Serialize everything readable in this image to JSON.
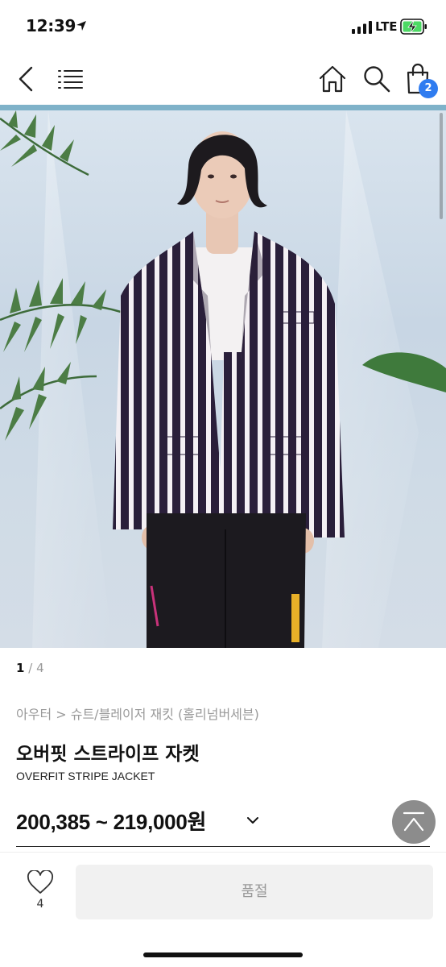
{
  "status_bar": {
    "time": "12:39",
    "network": "LTE"
  },
  "nav": {
    "cart_count": "2"
  },
  "gallery": {
    "current": "1",
    "separator": "/",
    "total": "4"
  },
  "product": {
    "breadcrumb": "아우터 > 슈트/블레이저 재킷 (홀리넘버세븐)",
    "title": "오버핏 스트라이프 자켓",
    "subtitle": "OVERFIT STRIPE JACKET",
    "price_range": "200,385 ~ 219,000원"
  },
  "actions": {
    "like_count": "4",
    "soldout_label": "품절"
  },
  "colors": {
    "accent_blue": "#2f7cf0",
    "divider": "#7fb2c9",
    "disabled_bg": "#f1f1f1"
  }
}
